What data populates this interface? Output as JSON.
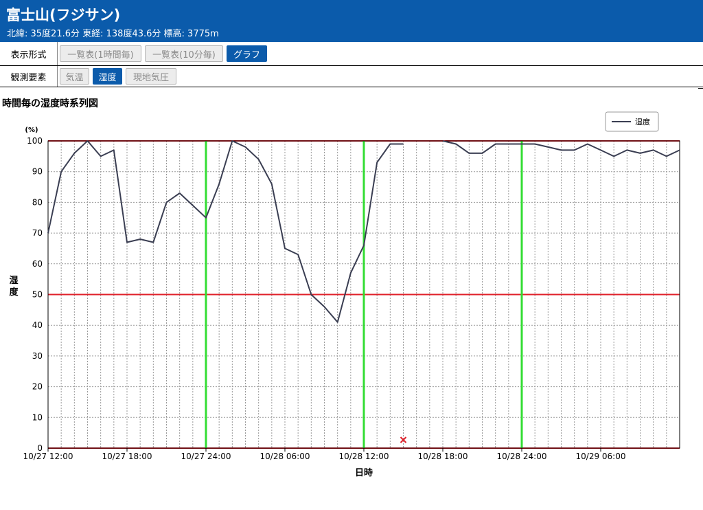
{
  "station": {
    "name": "富士山(フジサン)",
    "info": "北緯: 35度21.6分 東経: 138度43.6分 標高: 3775m"
  },
  "display_format": {
    "label": "表示形式",
    "buttons": [
      {
        "label": "一覧表(1時間毎)",
        "active": false
      },
      {
        "label": "一覧表(10分毎)",
        "active": false
      },
      {
        "label": "グラフ",
        "active": true
      }
    ]
  },
  "elements": {
    "label": "観測要素",
    "buttons": [
      {
        "label": "気温",
        "active": false
      },
      {
        "label": "湿度",
        "active": true
      },
      {
        "label": "現地気圧",
        "active": false
      }
    ]
  },
  "chart_title": "時間毎の湿度時系列図",
  "colors": {
    "header_bg": "#0b5bab",
    "line": "#3a3e52",
    "reference_line": "#e0202a",
    "day_line": "#33dd33",
    "missing_marker": "#e0202a"
  },
  "chart_data": {
    "type": "line",
    "y_unit": "(%)",
    "ylabel": "湿度",
    "xlabel": "日時",
    "ylim": [
      0,
      100
    ],
    "yticks": [
      0,
      10,
      20,
      30,
      40,
      50,
      60,
      70,
      80,
      90,
      100
    ],
    "x_start": "10/27 12:00",
    "x_end": "10/29 11:00",
    "x_tick_labels": [
      "10/27 12:00",
      "10/27 18:00",
      "10/27 24:00",
      "10/28 06:00",
      "10/28 12:00",
      "10/28 18:00",
      "10/28 24:00",
      "10/29 06:00"
    ],
    "reference_lines": [
      50,
      100
    ],
    "day_boundaries": [
      "10/27 24:00",
      "10/28 12:00",
      "10/28 24:00"
    ],
    "legend": {
      "entries": [
        "湿度"
      ],
      "position": "top-right"
    },
    "missing_marker_x": "10/28 15:00",
    "series": [
      {
        "name": "湿度",
        "values": [
          70,
          90,
          96,
          100,
          95,
          97,
          67,
          68,
          67,
          80,
          83,
          79,
          75,
          86,
          100,
          98,
          94,
          86,
          65,
          63,
          50,
          46,
          41,
          57,
          66,
          93,
          99,
          99,
          null,
          null,
          100,
          99,
          96,
          96,
          99,
          99,
          99,
          99,
          98,
          97,
          97,
          99,
          97,
          95,
          97,
          96,
          97,
          95,
          97
        ]
      }
    ]
  }
}
